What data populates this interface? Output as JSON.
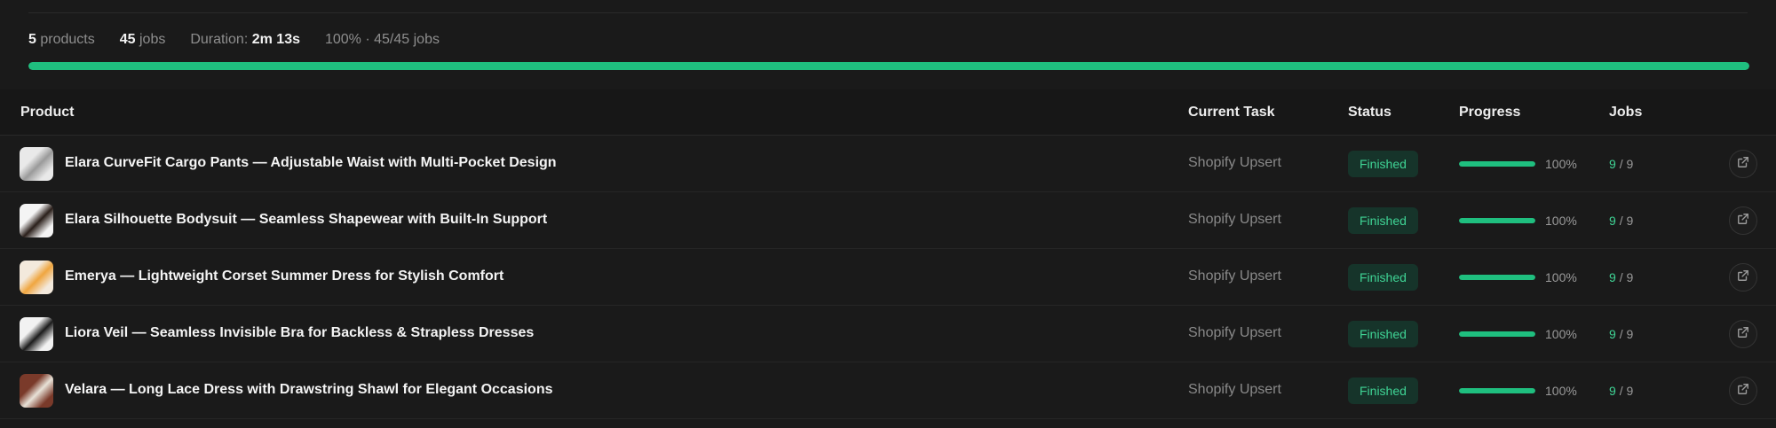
{
  "summary": {
    "products_count": "5",
    "products_label": "products",
    "jobs_count": "45",
    "jobs_label": "jobs",
    "duration_label": "Duration:",
    "duration_value": "2m 13s",
    "overall": "100% · 45/45 jobs",
    "overall_progress_percent": 100
  },
  "table": {
    "headers": {
      "product": "Product",
      "current_task": "Current Task",
      "status": "Status",
      "progress": "Progress",
      "jobs": "Jobs"
    },
    "rows": [
      {
        "name": "Elara CurveFit Cargo Pants — Adjustable Waist with Multi-Pocket Design",
        "task": "Shopify Upsert",
        "status": "Finished",
        "progress_percent": 100,
        "progress_label": "100%",
        "jobs_done": "9",
        "jobs_total": "/ 9",
        "thumb_colors": [
          "#e9e9e9",
          "#9a9a9a"
        ]
      },
      {
        "name": "Elara Silhouette Bodysuit — Seamless Shapewear with Built-In Support",
        "task": "Shopify Upsert",
        "status": "Finished",
        "progress_percent": 100,
        "progress_label": "100%",
        "jobs_done": "9",
        "jobs_total": "/ 9",
        "thumb_colors": [
          "#f4f4f4",
          "#2a1f1a"
        ]
      },
      {
        "name": "Emerya — Lightweight Corset Summer Dress for Stylish Comfort",
        "task": "Shopify Upsert",
        "status": "Finished",
        "progress_percent": 100,
        "progress_label": "100%",
        "jobs_done": "9",
        "jobs_total": "/ 9",
        "thumb_colors": [
          "#f3e9dc",
          "#f0a640"
        ]
      },
      {
        "name": "Liora Veil — Seamless Invisible Bra for Backless & Strapless Dresses",
        "task": "Shopify Upsert",
        "status": "Finished",
        "progress_percent": 100,
        "progress_label": "100%",
        "jobs_done": "9",
        "jobs_total": "/ 9",
        "thumb_colors": [
          "#f2f2f2",
          "#1c1c1c"
        ]
      },
      {
        "name": "Velara — Long Lace Dress with Drawstring Shawl for Elegant Occasions",
        "task": "Shopify Upsert",
        "status": "Finished",
        "progress_percent": 100,
        "progress_label": "100%",
        "jobs_done": "9",
        "jobs_total": "/ 9",
        "thumb_colors": [
          "#7a3a2a",
          "#e8e2d8"
        ]
      }
    ]
  },
  "colors": {
    "accent": "#1fbf7f",
    "badge_bg": "#16342a",
    "badge_text": "#3fd495"
  },
  "icons": {
    "row_action": "external-link-icon"
  }
}
